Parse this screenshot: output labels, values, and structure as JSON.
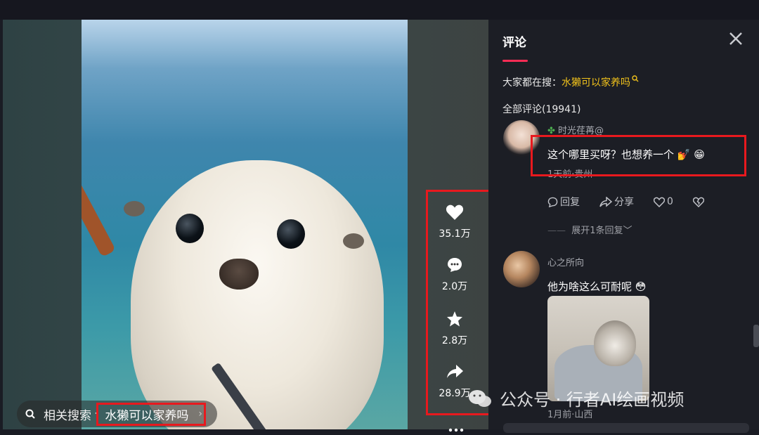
{
  "video": {
    "actions": [
      {
        "icon": "heart-icon",
        "count": "35.1万"
      },
      {
        "icon": "comment-icon",
        "count": "2.0万"
      },
      {
        "icon": "star-icon",
        "count": "2.8万"
      },
      {
        "icon": "share-icon",
        "count": "28.9万"
      }
    ],
    "related_search": {
      "label": "相关搜索",
      "separator": "·",
      "keyword": "水獭可以家养吗"
    }
  },
  "panel": {
    "tab": "评论",
    "hot_label": "大家都在搜：",
    "hot_keyword": "水獭可以家养吗",
    "all_comments": "全部评论(19941)",
    "comments": [
      {
        "user": "时光荏苒@",
        "text": "这个哪里买呀？也想养一个",
        "emoji": "💅 😁",
        "meta": "1天前·贵州",
        "reply": "回复",
        "share": "分享",
        "likes": "0",
        "expand": "展开1条回复"
      },
      {
        "user": "心之所向",
        "text": "他为啥这么可耐呢",
        "emoji": "😳",
        "meta": "1月前·山西"
      }
    ]
  },
  "watermark": "公众号 · 行者AI绘画视频",
  "colors": {
    "accent": "#fe2c55",
    "highlight": "#f1c21b",
    "annotation": "#e8191e"
  }
}
